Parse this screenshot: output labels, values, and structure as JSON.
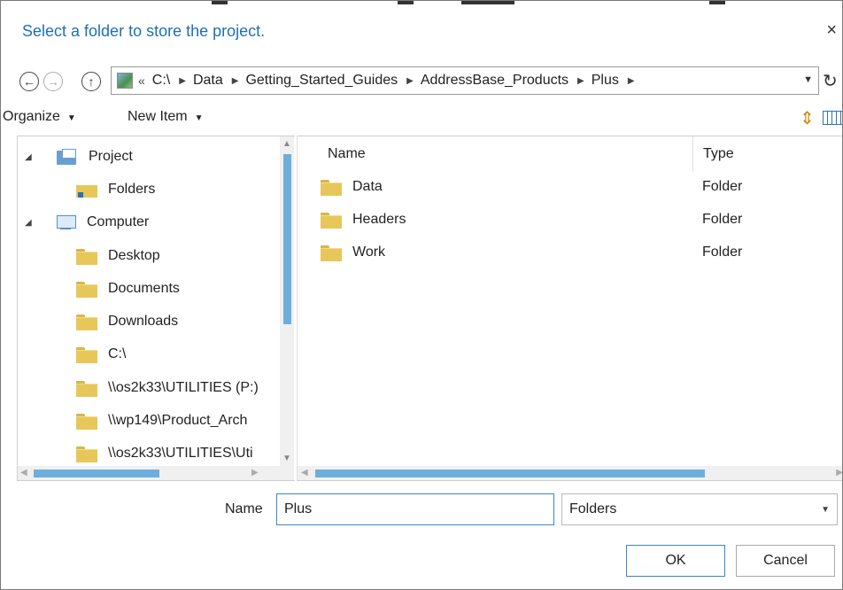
{
  "dialog": {
    "title": "Select a folder to store the project.",
    "close_glyph": "×"
  },
  "address": {
    "back_glyph": "←",
    "forward_glyph": "→",
    "up_glyph": "↑",
    "overflow_glyph": "«",
    "crumbs": [
      "C:\\",
      "Data",
      "Getting_Started_Guides",
      "AddressBase_Products",
      "Plus"
    ],
    "dropdown_glyph": "▼",
    "refresh_glyph": "↻"
  },
  "toolbar": {
    "organize_label": "Organize",
    "new_item_label": "New Item",
    "caret": "▼",
    "sort_glyph": "⇕"
  },
  "nav_tree": [
    {
      "label": "Project",
      "icon": "project-icon",
      "expanded": true
    },
    {
      "label": "Folders",
      "icon": "folders-icon"
    },
    {
      "label": "Computer",
      "icon": "computer-icon",
      "expanded": true
    },
    {
      "label": "Desktop",
      "icon": "folder-icon"
    },
    {
      "label": "Documents",
      "icon": "folder-icon"
    },
    {
      "label": "Downloads",
      "icon": "folder-icon"
    },
    {
      "label": "C:\\",
      "icon": "folder-icon"
    },
    {
      "label": "\\\\os2k33\\UTILITIES (P:)",
      "icon": "folder-icon"
    },
    {
      "label": "\\\\wp149\\Product_Arch",
      "icon": "folder-icon"
    },
    {
      "label": "\\\\os2k33\\UTILITIES\\Uti",
      "icon": "folder-icon"
    }
  ],
  "expander_glyph": "◢",
  "file_list": {
    "columns": {
      "name": "Name",
      "type": "Type"
    },
    "rows": [
      {
        "name": "Data",
        "type": "Folder"
      },
      {
        "name": "Headers",
        "type": "Folder"
      },
      {
        "name": "Work",
        "type": "Folder"
      }
    ]
  },
  "scroll_glyphs": {
    "up": "▲",
    "down": "▼",
    "left": "◀",
    "right": "▶"
  },
  "footer": {
    "name_label": "Name",
    "name_value": "Plus",
    "type_value": "Folders",
    "type_caret": "▼",
    "ok_label": "OK",
    "cancel_label": "Cancel"
  },
  "colors": {
    "accent": "#1e6fb8",
    "folder": "#e8c75a",
    "scroll_thumb": "#6eaedd"
  }
}
